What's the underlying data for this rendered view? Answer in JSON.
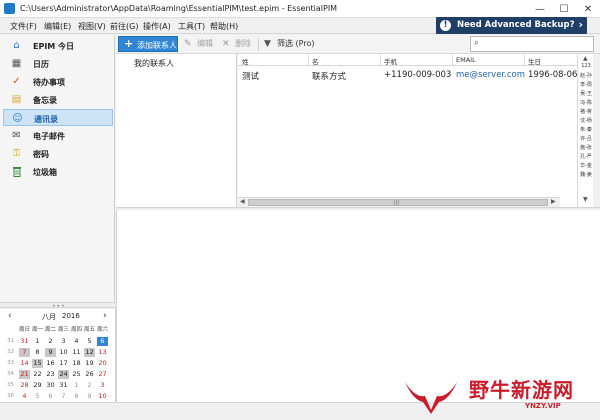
{
  "window": {
    "title": "C:\\Users\\Administrator\\AppData\\Roaming\\EssentialPIM\\test.epim - EssentialPIM",
    "buttons": {
      "minimize": "—",
      "maximize": "☐",
      "close": "✕"
    }
  },
  "menu": [
    "文件(F)",
    "编辑(E)",
    "视图(V)",
    "前往(G)",
    "操作(A)",
    "工具(T)",
    "帮助(H)"
  ],
  "banner": {
    "icon": "!",
    "text": "Need Advanced Backup?",
    "arrow": "›"
  },
  "sidebar": {
    "items": [
      {
        "label": "EPIM 今日",
        "icon": "house-icon",
        "glyph": "⌂"
      },
      {
        "label": "日历",
        "icon": "calendar-icon",
        "glyph": "▦"
      },
      {
        "label": "待办事项",
        "icon": "todo-icon",
        "glyph": "✓"
      },
      {
        "label": "备忘录",
        "icon": "notes-icon",
        "glyph": "▤"
      },
      {
        "label": "通讯录",
        "icon": "contacts-icon",
        "glyph": "☺",
        "active": true
      },
      {
        "label": "电子邮件",
        "icon": "mail-icon",
        "glyph": "✉"
      },
      {
        "label": "密码",
        "icon": "key-icon",
        "glyph": "⚿"
      },
      {
        "label": "垃圾箱",
        "icon": "trash-icon",
        "glyph": "🗑"
      }
    ]
  },
  "calendar": {
    "prev": "‹",
    "next": "›",
    "month": "八月",
    "year": "2016",
    "weekdays": [
      "周日",
      "周一",
      "周二",
      "周三",
      "周四",
      "周五",
      "周六"
    ],
    "weeks": [
      {
        "wk": "31",
        "days": [
          "31",
          "1",
          "2",
          "3",
          "4",
          "5",
          "6"
        ]
      },
      {
        "wk": "32",
        "days": [
          "7",
          "8",
          "9",
          "10",
          "11",
          "12",
          "13"
        ]
      },
      {
        "wk": "33",
        "days": [
          "14",
          "15",
          "16",
          "17",
          "18",
          "19",
          "20"
        ]
      },
      {
        "wk": "34",
        "days": [
          "21",
          "22",
          "23",
          "24",
          "25",
          "26",
          "27"
        ]
      },
      {
        "wk": "35",
        "days": [
          "28",
          "29",
          "30",
          "31",
          "1",
          "2",
          "3"
        ]
      },
      {
        "wk": "36",
        "days": [
          "4",
          "5",
          "6",
          "7",
          "8",
          "9",
          "10"
        ]
      }
    ],
    "today": "6"
  },
  "toolbar": {
    "add_contact": "添加联系人",
    "edit": "编辑",
    "delete": "删除",
    "filter": "筛选 (Pro)",
    "search_placeholder": ""
  },
  "groups": {
    "my_contacts": "我的联系人"
  },
  "contacts": {
    "columns": [
      "姓",
      "名",
      "手机",
      "EMAIL",
      "生日"
    ],
    "rows": [
      {
        "surname": "测试",
        "name": "联系方式",
        "mobile": "+1190-009-003",
        "email": "me@server.com",
        "birthday": "1996-08-06"
      }
    ]
  },
  "alpha_index": [
    "123",
    "赵-孙",
    "李-周",
    "吴-王",
    "冯-陈",
    "褚-蒋",
    "沈-杨",
    "朱-秦",
    "许-吕",
    "施-张",
    "孔-严",
    "华-金",
    "魏-姜"
  ],
  "watermark": {
    "name": "野牛新游网",
    "url": "YNZY.VIP"
  }
}
